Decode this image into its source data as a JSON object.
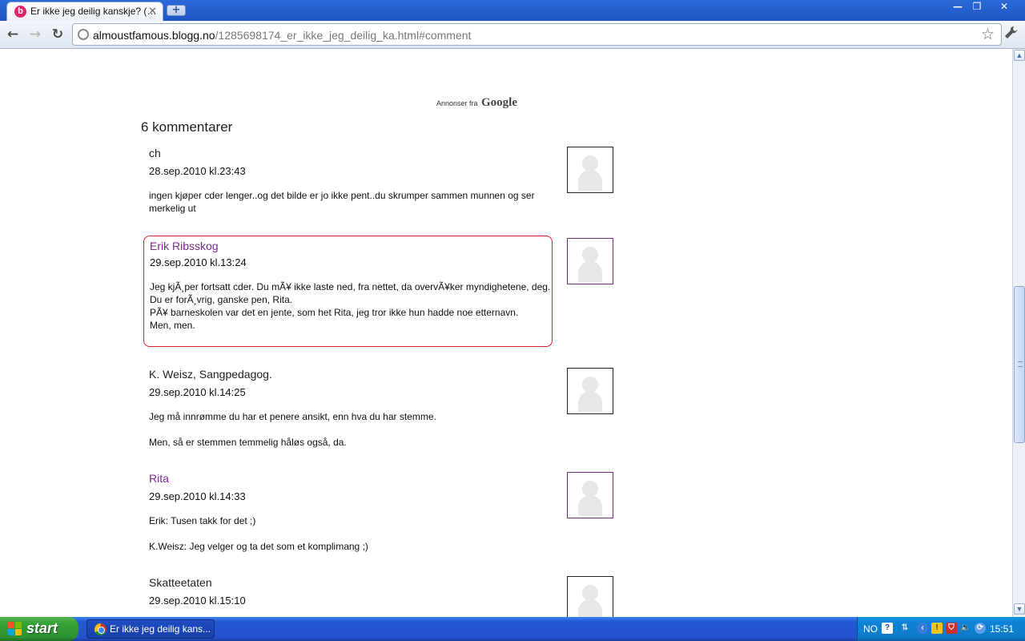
{
  "browser": {
    "tab_title": "Er ikke jeg deilig kanskje? (…",
    "tab_favicon_letter": "b",
    "tab_close": "✕",
    "new_tab": "+",
    "url_host": "almoustfamous.bloggno",
    "url_host_display": "almoustfamous.blogg.no",
    "url_path": "/1285698174_er_ikke_jeg_deilig_ka.html#comment",
    "window_controls": {
      "minimize": "—",
      "restore": "❐",
      "close": "✕"
    },
    "nav": {
      "back": "←",
      "forward": "→",
      "reload": "↻",
      "bookmark": "☆",
      "menu": "🔧"
    }
  },
  "page": {
    "ads_prefix": "Annonser fra",
    "ads_brand": "Google",
    "comment_count": "6 kommentarer",
    "comments": [
      {
        "name": "ch",
        "linked": false,
        "date": "28.sep.2010 kl.23:43",
        "paragraphs": [
          "ingen kjøper cder lenger..og det bilde er jo ikke pent..du skrumper sammen munnen og ser merkelig ut"
        ]
      },
      {
        "name": "Erik Ribsskog",
        "linked": true,
        "highlighted": true,
        "date": "29.sep.2010 kl.13:24",
        "paragraphs": [
          "Jeg kjÃ¸per fortsatt cder. Du mÃ¥ ikke laste ned, fra nettet, da overvÃ¥ker myndighetene, deg.\nDu er forÃ¸vrig, ganske pen, Rita.\nPÃ¥ barneskolen var det en jente, som het Rita, jeg tror ikke hun hadde noe etternavn.\nMen, men."
        ]
      },
      {
        "name": "K. Weisz, Sangpedagog.",
        "linked": false,
        "date": "29.sep.2010 kl.14:25",
        "paragraphs": [
          "Jeg må innrømme du har et penere ansikt, enn hva du har stemme.",
          "Men, så er stemmen temmelig håløs også, da."
        ]
      },
      {
        "name": "Rita",
        "linked": true,
        "date": "29.sep.2010 kl.14:33",
        "paragraphs": [
          "Erik: Tusen takk for det ;)",
          "K.Weisz: Jeg velger og ta det som et komplimang ;)"
        ]
      },
      {
        "name": "Skatteetaten",
        "linked": false,
        "date": "29.sep.2010 kl.15:10",
        "paragraphs": []
      }
    ]
  },
  "taskbar": {
    "start_label": "start",
    "task_label": "Er ikke jeg deilig kans...",
    "language": "NO",
    "clock": "15:51"
  },
  "colors": {
    "link_purple": "#7a2a8c",
    "highlight_red": "#d9212e",
    "xp_blue": "#2553cf",
    "start_green": "#35a136"
  }
}
